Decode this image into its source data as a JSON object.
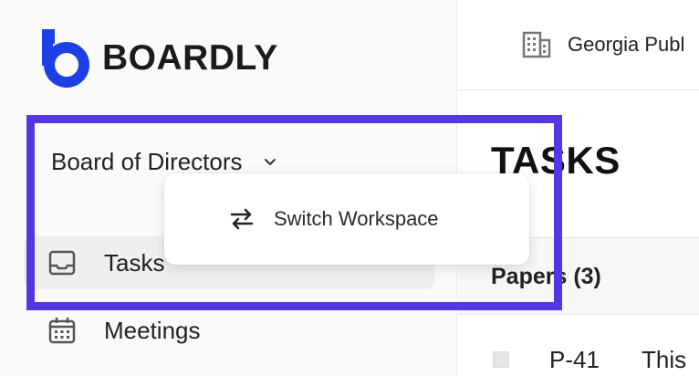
{
  "brand": {
    "name": "BOARDLY",
    "accent": "#1c3fe6"
  },
  "sidebar": {
    "workspace": {
      "name": "Board of Directors"
    },
    "nav": [
      {
        "label": "Tasks",
        "icon": "inbox-icon",
        "active": true
      },
      {
        "label": "Meetings",
        "icon": "calendar-icon",
        "active": false
      }
    ]
  },
  "dropdown": {
    "items": [
      {
        "label": "Switch Workspace",
        "icon": "swap-arrows-icon"
      }
    ]
  },
  "header": {
    "org_name": "Georgia Publ",
    "org_icon": "building-icon"
  },
  "main": {
    "title": "TASKS",
    "papers_header": "Papers (3)",
    "rows": [
      {
        "id": "P-41",
        "text": "This"
      }
    ]
  },
  "highlight": {
    "color": "#5636e0"
  }
}
